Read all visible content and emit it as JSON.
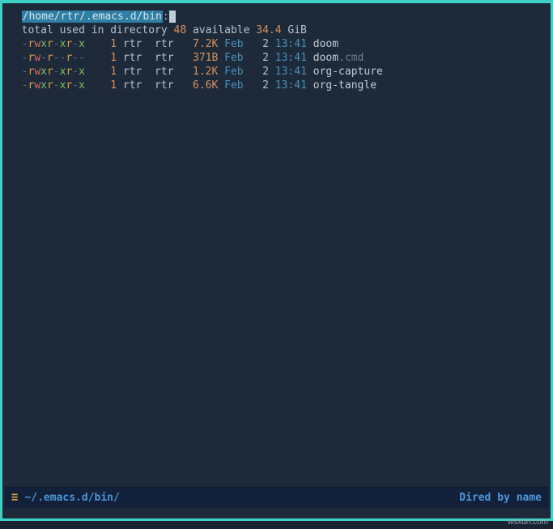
{
  "header": {
    "path": "/home/rtr/.emacs.d/bin",
    "suffix": ":"
  },
  "summary": {
    "prefix": "total used in directory",
    "used": "48",
    "mid": "available",
    "avail": "34.4",
    "unit": "GiB"
  },
  "rows": [
    {
      "perm": [
        "-",
        "r",
        "w",
        "x",
        "r",
        "-",
        "x",
        "r",
        "-",
        "x"
      ],
      "links": "1",
      "owner": "rtr",
      "group": "rtr",
      "size": "7.2K",
      "month": "Feb",
      "day": "2",
      "time": "13:41",
      "name": "doom",
      "ext": ""
    },
    {
      "perm": [
        "-",
        "r",
        "w",
        "-",
        "r",
        "-",
        "-",
        "r",
        "-",
        "-"
      ],
      "links": "1",
      "owner": "rtr",
      "group": "rtr",
      "size": "371B",
      "month": "Feb",
      "day": "2",
      "time": "13:41",
      "name": "doom",
      "ext": ".cmd"
    },
    {
      "perm": [
        "-",
        "r",
        "w",
        "x",
        "r",
        "-",
        "x",
        "r",
        "-",
        "x"
      ],
      "links": "1",
      "owner": "rtr",
      "group": "rtr",
      "size": "1.2K",
      "month": "Feb",
      "day": "2",
      "time": "13:41",
      "name": "org-capture",
      "ext": ""
    },
    {
      "perm": [
        "-",
        "r",
        "w",
        "x",
        "r",
        "-",
        "x",
        "r",
        "-",
        "x"
      ],
      "links": "1",
      "owner": "rtr",
      "group": "rtr",
      "size": "6.6K",
      "month": "Feb",
      "day": "2",
      "time": "13:41",
      "name": "org-tangle",
      "ext": ""
    }
  ],
  "modeline": {
    "hamburger": "≡",
    "path": "~/.emacs.d/bin/",
    "mode": "Dired by name"
  },
  "watermark": "wsxdn.com"
}
